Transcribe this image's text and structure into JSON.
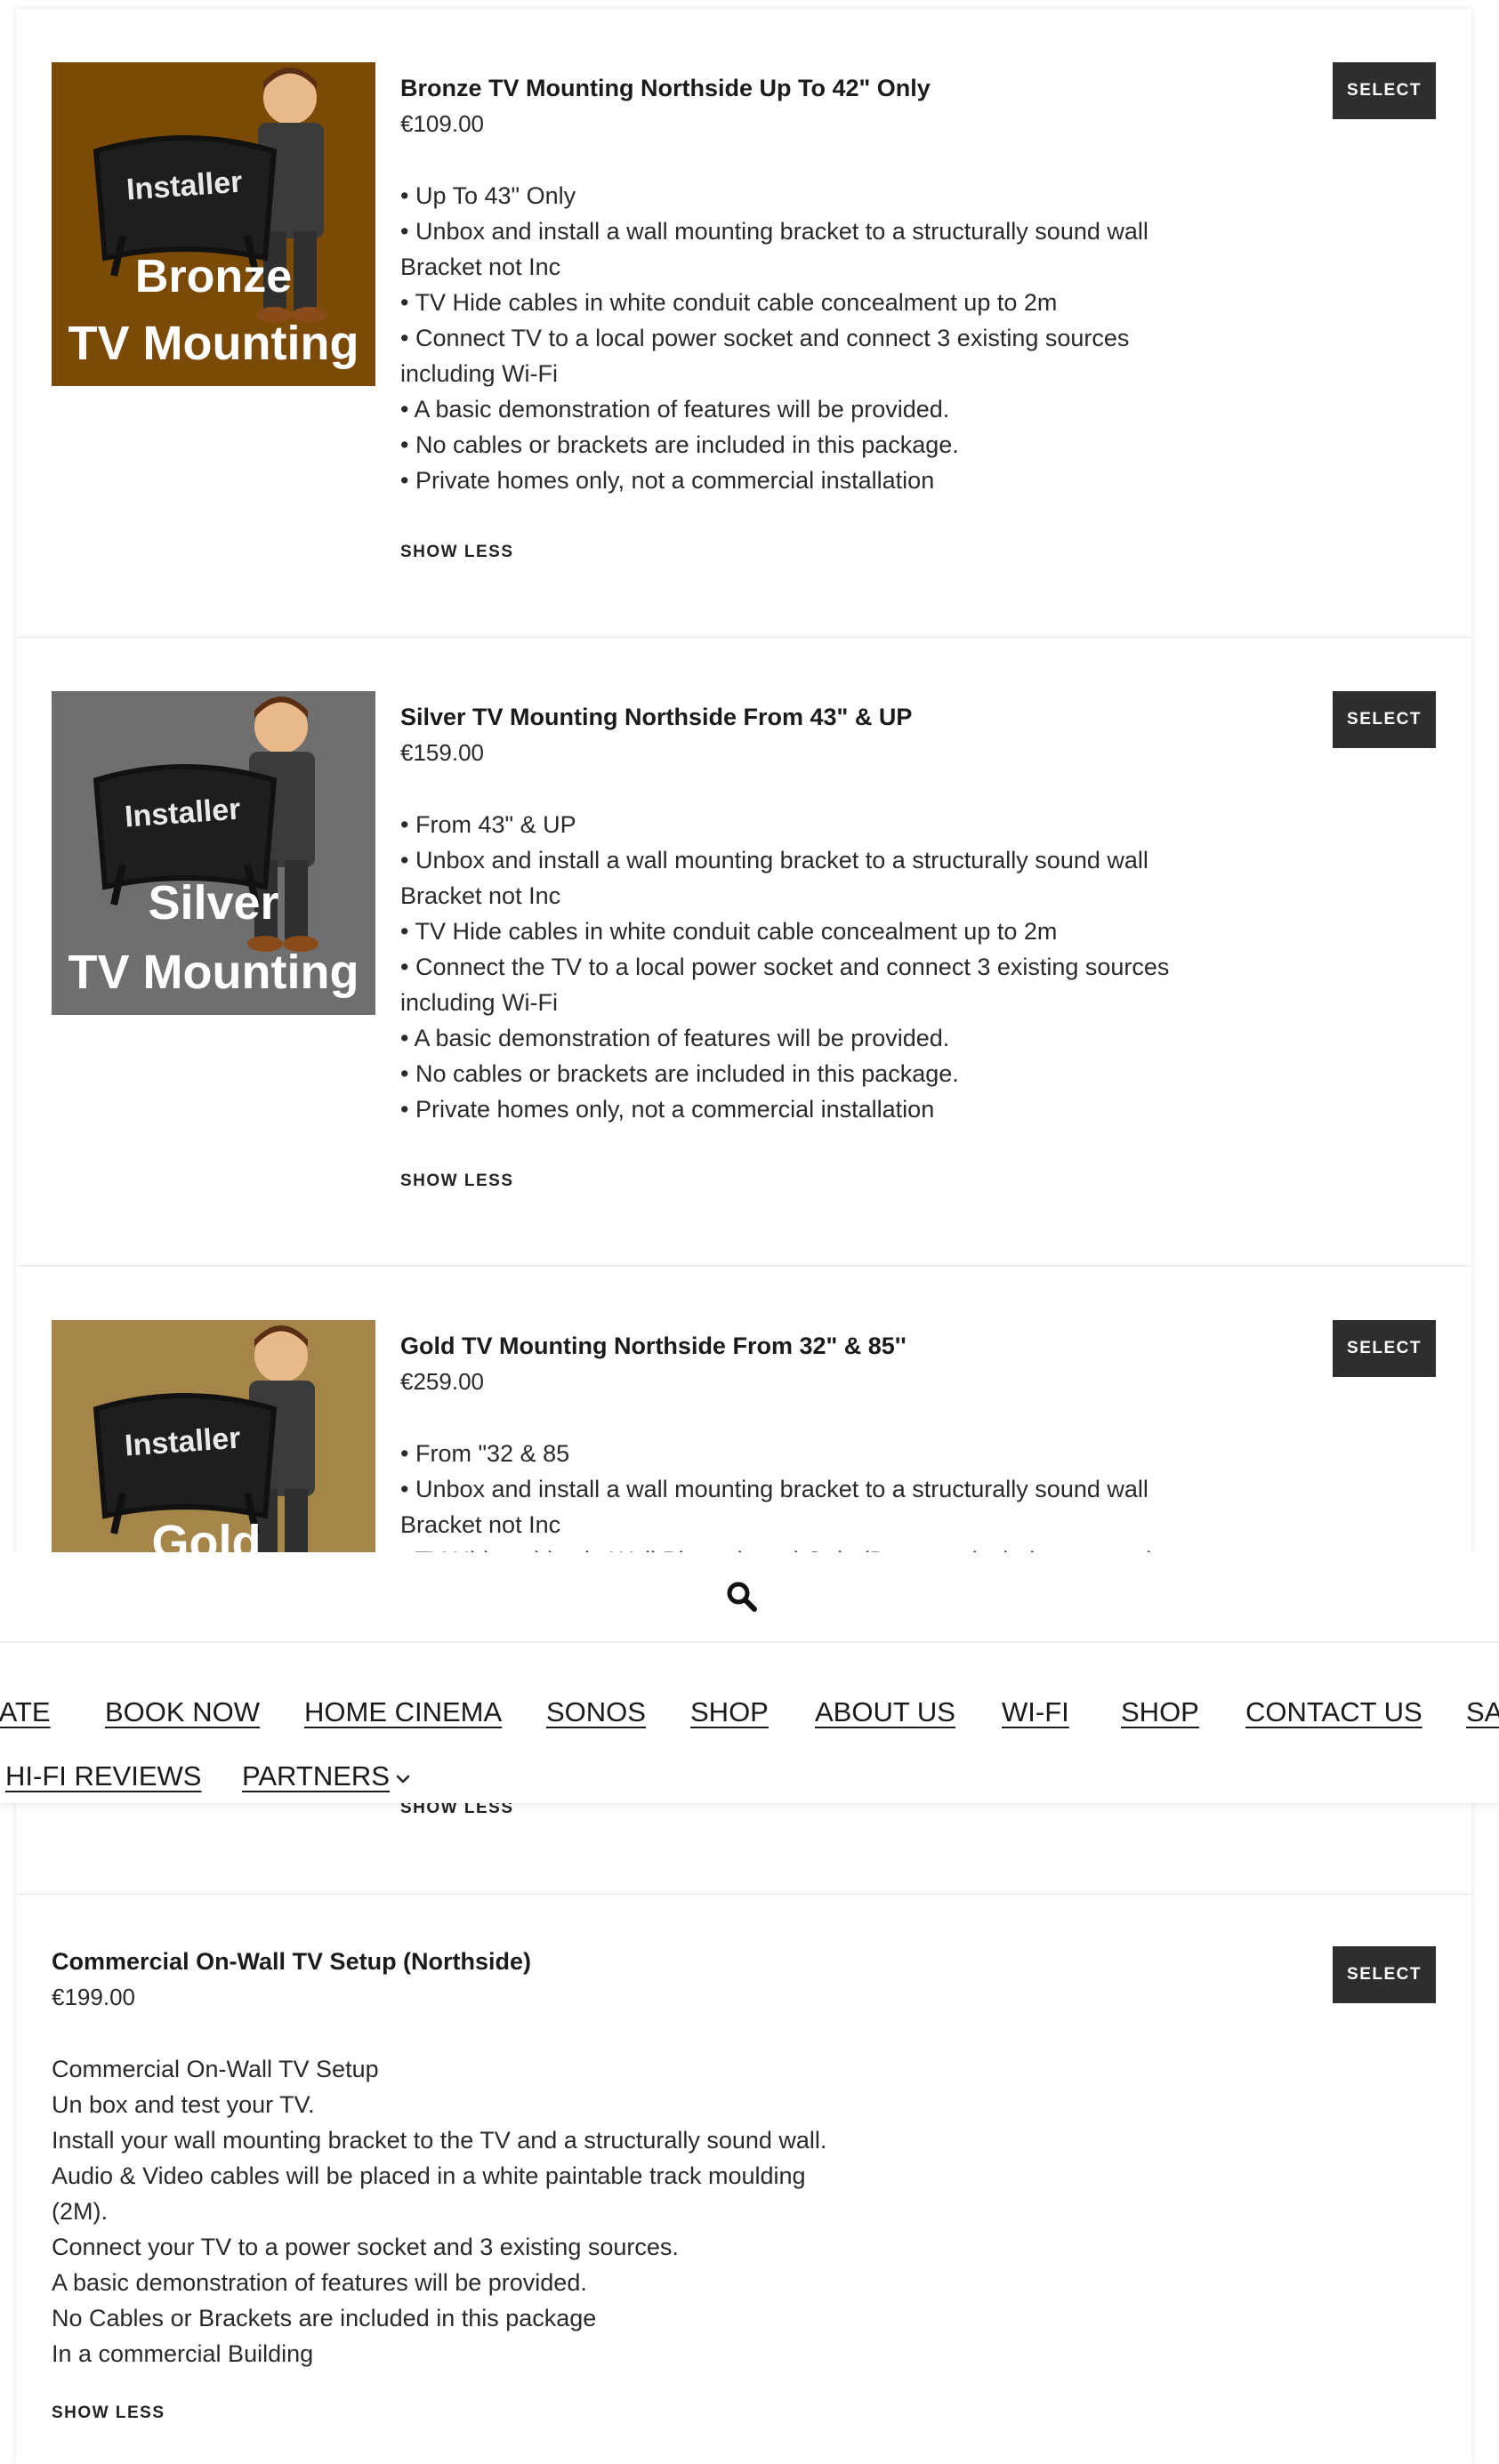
{
  "products": [
    {
      "title": "Bronze TV Mounting Northside Up To 42\" Only",
      "price": "€109.00",
      "select_label": "SELECT",
      "show_less_label": "SHOW LESS",
      "image": {
        "brand": "Installer",
        "line1": "Bronze",
        "line2": "TV Mounting",
        "bg": "#7b4a06"
      },
      "description": [
        "• Up To 43\" Only",
        "• Unbox and install a wall mounting bracket to a structurally sound wall",
        "Bracket not Inc",
        "• TV Hide cables in white conduit cable concealment up to 2m",
        "• Connect TV to a local power socket and connect 3 existing sources",
        "including Wi-Fi",
        "• A basic demonstration of features will be provided.",
        "• No cables or brackets are included in this package.",
        "• Private homes only, not a commercial installation"
      ]
    },
    {
      "title": "Silver TV Mounting Northside From 43\" & UP",
      "price": "€159.00",
      "select_label": "SELECT",
      "show_less_label": "SHOW LESS",
      "image": {
        "brand": "Installer",
        "line1": "Silver",
        "line2": "TV Mounting",
        "bg": "#6f6f6f"
      },
      "description": [
        "• From 43\" & UP",
        "• Unbox and install a wall mounting bracket to a structurally sound wall",
        "Bracket not Inc",
        "• TV Hide cables in white conduit cable concealment up to 2m",
        "• Connect the TV to a local power socket and connect 3 existing sources",
        "including Wi-Fi",
        "• A basic demonstration of features will be provided.",
        "• No cables or brackets are included in this package.",
        "• Private homes only, not a commercial installation"
      ]
    },
    {
      "title": "Gold TV Mounting Northside From 32\" & 85''",
      "price": "€259.00",
      "select_label": "SELECT",
      "show_less_label": "SHOW LESS",
      "image": {
        "brand": "Installer",
        "line1": "Gold",
        "line2": "",
        "bg": "#a5854a"
      },
      "description": [
        "• From \"32 & 85",
        "• Unbox and install a wall mounting bracket to a structurally sound wall",
        "Bracket not Inc",
        "• TV Hide cables in Wall Plasterboard Only (Does not include concrete)"
      ]
    },
    {
      "title": "Commercial On-Wall TV Setup (Northside)",
      "price": "€199.00",
      "select_label": "SELECT",
      "show_less_label": "SHOW LESS",
      "description": [
        "Commercial On-Wall TV Setup",
        "Un box and test your TV.",
        "Install your wall mounting bracket to the TV and a structurally sound wall.",
        "Audio & Video cables will be placed in a white paintable track moulding (2M).",
        "Connect your TV to a power socket and 3 existing sources.",
        "A basic demonstration of features will be provided.",
        "No Cables or Brackets are included in this package",
        "In a commercial Building"
      ]
    }
  ],
  "header": {
    "search_icon": "search-icon",
    "nav_row1": [
      "IATE",
      "BOOK NOW",
      "HOME CINEMA",
      "SONOS",
      "SHOP",
      "ABOUT US",
      "WI-FI",
      "SHOP",
      "CONTACT US",
      "SA"
    ],
    "nav_row2": [
      "HI-FI REVIEWS",
      "PARTNERS"
    ],
    "dropdown_icon": "chevron-down-icon"
  }
}
